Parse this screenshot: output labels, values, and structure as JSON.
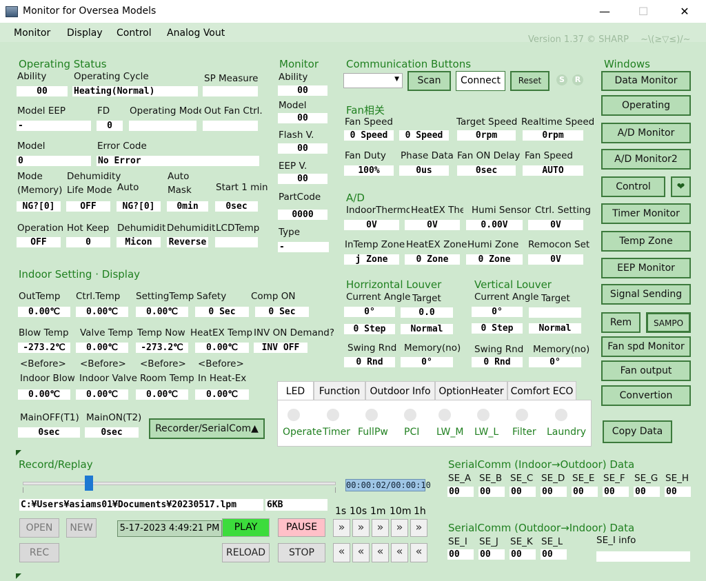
{
  "window": {
    "title": "Monitor for Oversea Models",
    "minimize": "—",
    "maximize": "☐",
    "close": "✕"
  },
  "menu": [
    "Monitor",
    "Display",
    "Control",
    "Analog Vout"
  ],
  "version": "Version 1.37 © SHARP　 ~\\(≥▽≤)/~",
  "operating_status": {
    "title": "Operating Status",
    "ability_label": "Ability",
    "ability": "00",
    "cycle_label": "Operating Cycle",
    "cycle": "Heating(Normal)",
    "sp_label": "SP Measure",
    "sp": "",
    "eep_label": "Model EEP",
    "eep": "-",
    "fd_label": "FD",
    "fd": "0",
    "opmode_label": "Operating Mode",
    "opmode": "",
    "outfan_label": "Out Fan Ctrl.",
    "outfan": "",
    "model_label": "Model",
    "model": "0",
    "error_label": "Error Code",
    "error": "No Error",
    "mode_label1": "Mode",
    "mode_label2": "(Memory)",
    "mode": "NG?[0]",
    "dehum_label1": "Dehumidity",
    "dehum_label2": "Life Mode",
    "dehum": "OFF",
    "auto_label": "Auto",
    "auto": "NG?[0]",
    "automask_label1": "Auto",
    "automask_label2": "Mask",
    "automask": "0min",
    "start_label": "Start 1 min",
    "start": "0sec",
    "operation_label": "Operation",
    "operation": "OFF",
    "hotkeep_label": "Hot Keep",
    "hotkeep": "0",
    "dehumid1_label": "Dehumidit",
    "dehumid1": "Micon",
    "dehumid2_label": "Dehumidit",
    "dehumid2": "Reverse",
    "lcd_label": "LCDTemp",
    "lcd": ""
  },
  "monitor": {
    "title": "Monitor",
    "ability_label": "Ability",
    "ability": "00",
    "model_label": "Model",
    "model": "00",
    "flash_label": "Flash V.",
    "flash": "00",
    "eep_label": "EEP V.",
    "eep": "00",
    "part_label": "PartCode",
    "part": "0000",
    "type_label": "Type",
    "type": "-"
  },
  "comm": {
    "title": "Communication Buttons",
    "scan": "Scan",
    "connect": "Connect",
    "reset": "Reset",
    "s": "S",
    "r": "R"
  },
  "fan": {
    "title": "Fan相关",
    "fan_speed_label": "Fan Speed",
    "fan_speed1": "0 Speed",
    "fan_speed2": "0 Speed",
    "target_label": "Target Speed",
    "target": "0rpm",
    "realtime_label": "Realtime Speed",
    "realtime": "0rpm",
    "duty_label": "Fan Duty",
    "duty": "100%",
    "phase_label": "Phase Data",
    "phase": "0us",
    "ondelay_label": "Fan ON Delay",
    "ondelay": "0sec",
    "speed_label": "Fan Speed",
    "speed": "AUTO"
  },
  "ad": {
    "title": "A/D",
    "indoor_label": "IndoorThermo",
    "indoor": "0V",
    "heatex_label": "HeatEX Therm",
    "heatex": "0V",
    "humi_label": "Humi Sensor",
    "humi": "0.00V",
    "ctrl_label": "Ctrl. Setting",
    "ctrl": "0V",
    "intemp_label": "InTemp Zone",
    "intemp": "j Zone",
    "hexzone_label": "HeatEX Zone",
    "hexzone": "0 Zone",
    "humizone_label": "Humi Zone",
    "humizone": "0 Zone",
    "remocon_label": "Remocon Set",
    "remocon": "0V"
  },
  "h_louver": {
    "title": "Horrizontal Louver",
    "angle_label": "Current Angle",
    "angle": "0°",
    "target_label": "Target",
    "target": "0.0",
    "step": "0 Step",
    "mode": "Normal",
    "swing_label": "Swing Rnd",
    "swing": "0 Rnd",
    "memory_label": "Memory(no)",
    "memory": "0°"
  },
  "v_louver": {
    "title": "Vertical Louver",
    "angle_label": "Current Angle",
    "angle": "0°",
    "target_label": "Target",
    "target": "",
    "step": "0 Step",
    "mode": "Normal",
    "swing_label": "Swing Rnd",
    "swing": "0 Rnd",
    "memory_label": "Memory(no)",
    "memory": "0°"
  },
  "indoor": {
    "title": "Indoor Setting · Display",
    "outtemp_label": "OutTemp",
    "outtemp": "0.00℃",
    "ctrltemp_label": "Ctrl.Temp",
    "ctrltemp": "0.00℃",
    "settemp_label": "SettingTemp",
    "settemp": "0.00℃",
    "safety_label": "Safety",
    "safety": "0 Sec",
    "comp_label": "Comp ON",
    "comp": "0 Sec",
    "blow_label": "Blow Temp",
    "blow": "-273.2℃",
    "valve_label": "Valve Temp",
    "valve": "0.00℃",
    "now_label": "Temp Now",
    "now": "-273.2℃",
    "hex_label": "HeatEX Temp",
    "hex": "0.00℃",
    "inv_label": "INV ON Demand?",
    "inv": "INV OFF",
    "before": "<Before>",
    "iblow_label": "Indoor Blow",
    "iblow": "0.00℃",
    "ivalve_label": "Indoor Valve",
    "ivalve": "0.00℃",
    "room_label": "Room Temp",
    "room": "0.00℃",
    "inhex_label": "In Heat-Ex",
    "inhex": "0.00℃",
    "mainoff_label": "MainOFF(T1)",
    "mainoff": "0sec",
    "mainon_label": "MainON(T2)",
    "mainon": "0sec",
    "recorder": "Recorder/SerialCom▲"
  },
  "tabs": [
    "LED",
    "Function",
    "Outdoor Info",
    "OptionHeater",
    "Comfort ECO"
  ],
  "leds": [
    "Operate",
    "Timer",
    "FullPw",
    "PCI",
    "LW_M",
    "LW_L",
    "Filter",
    "Laundry"
  ],
  "windows": {
    "title": "Windows",
    "buttons": [
      "Data Monitor",
      "Operating",
      "A/D Monitor",
      "A/D Monitor2",
      "Control",
      "Timer Monitor",
      "Temp Zone",
      "EEP Monitor",
      "Signal Sending",
      "Rem",
      "SAMPO",
      "Fan spd Monitor",
      "Fan output",
      "Convertion"
    ],
    "heart": "❤",
    "copy": "Copy Data"
  },
  "record": {
    "title": "Record/Replay",
    "slider_progress": 0.2,
    "time": "00:00:02/00:00:10",
    "path": "C:¥Users¥asiams01¥Documents¥20230517.lpm",
    "size": "6KB",
    "datetime": "5-17-2023 4:49:21 PM",
    "open": "OPEN",
    "new": "NEW",
    "rec": "REC",
    "play": "PLAY",
    "pause": "PAUSE",
    "reload": "RELOAD",
    "stop": "STOP",
    "steps": [
      "1s",
      "10s",
      "1m",
      "10m",
      "1h"
    ],
    "fwd": "»",
    "back": "«"
  },
  "serial_io": {
    "title": "SerialComm (Indoor→Outdoor) Data",
    "labels": [
      "SE_A",
      "SE_B",
      "SE_C",
      "SE_D",
      "SE_E",
      "SE_F",
      "SE_G",
      "SE_H"
    ],
    "values": [
      "00",
      "00",
      "00",
      "00",
      "00",
      "00",
      "00",
      "00"
    ]
  },
  "serial_oi": {
    "title": "SerialComm (Outdoor→Indoor) Data",
    "labels": [
      "SE_I",
      "SE_J",
      "SE_K",
      "SE_L"
    ],
    "values": [
      "00",
      "00",
      "00",
      "00"
    ],
    "info_label": "SE_I info",
    "info": ""
  }
}
